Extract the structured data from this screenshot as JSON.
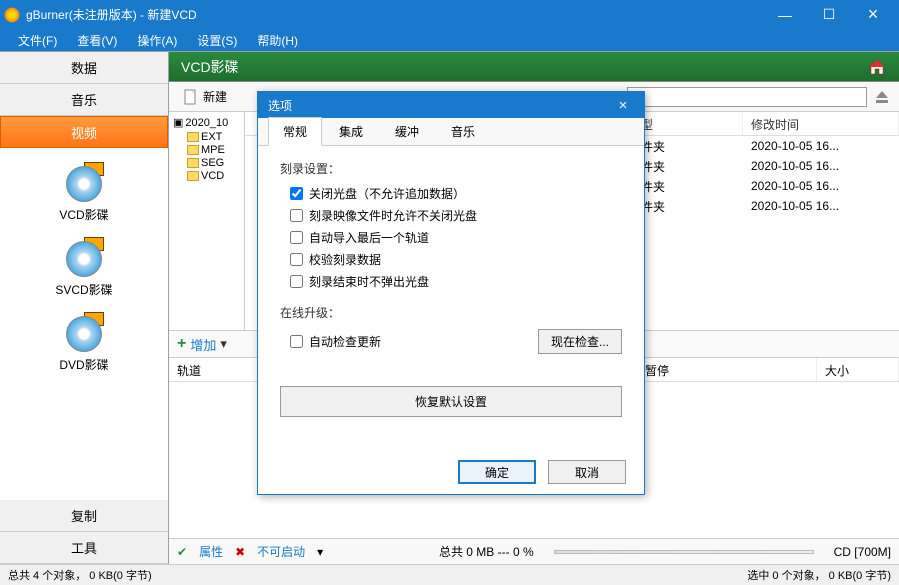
{
  "titlebar": {
    "title": "gBurner(未注册版本) - 新建VCD"
  },
  "menus": {
    "file": "文件(F)",
    "view": "查看(V)",
    "action": "操作(A)",
    "settings": "设置(S)",
    "help": "帮助(H)"
  },
  "sidebar": {
    "data": "数据",
    "music": "音乐",
    "video": "视频",
    "copy": "复制",
    "tools": "工具",
    "items": [
      {
        "label": "VCD影碟"
      },
      {
        "label": "SVCD影碟"
      },
      {
        "label": "DVD影碟"
      }
    ]
  },
  "header": {
    "title": "VCD影碟"
  },
  "toolbar": {
    "new": "新建"
  },
  "tree": {
    "root": "2020_10",
    "children": [
      "EXT",
      "MPE",
      "SEG",
      "VCD"
    ]
  },
  "filelist": {
    "cols": {
      "type": "型",
      "modified": "修改时间"
    },
    "rows": [
      {
        "type": "件夹",
        "modified": "2020-10-05 16..."
      },
      {
        "type": "件夹",
        "modified": "2020-10-05 16..."
      },
      {
        "type": "件夹",
        "modified": "2020-10-05 16..."
      },
      {
        "type": "件夹",
        "modified": "2020-10-05 16..."
      }
    ]
  },
  "addbar": {
    "add": "增加"
  },
  "track": {
    "cols": {
      "track": "轨道",
      "pause": "暂停",
      "size": "大小"
    }
  },
  "bottombar": {
    "props": "属性",
    "bootable": "不可启动",
    "total": "总共  0 MB  --- 0 %",
    "media": "CD [700M]"
  },
  "statusbar": {
    "left": "总共 4 个对象， 0 KB(0 字节)",
    "right": "选中 0 个对象， 0 KB(0 字节)"
  },
  "modal": {
    "title": "选项",
    "tabs": {
      "general": "常规",
      "integration": "集成",
      "cache": "缓冲",
      "music": "音乐"
    },
    "burn": {
      "legend": "刻录设置：",
      "finalize": "关闭光盘（不允许追加数据）",
      "allow_image": "刻录映像文件时允许不关闭光盘",
      "auto_import": "自动导入最后一个轨道",
      "verify": "校验刻录数据",
      "no_eject": "刻录结束时不弹出光盘"
    },
    "update": {
      "legend": "在线升级：",
      "auto_check": "自动检查更新",
      "check_now": "现在检查..."
    },
    "restore": "恢复默认设置",
    "ok": "确定",
    "cancel": "取消"
  }
}
